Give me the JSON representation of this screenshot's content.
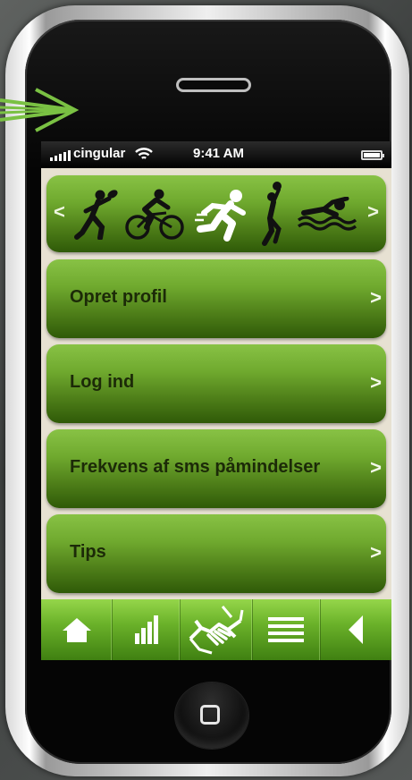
{
  "status_bar": {
    "carrier": "cingular",
    "time": "9:41 AM",
    "signal_icon": "signal-bars-icon",
    "wifi_icon": "wifi-icon",
    "battery_icon": "battery-icon"
  },
  "sports_row": {
    "prev_label": "<",
    "next_label": ">",
    "icons": [
      "rugby-player-icon",
      "cyclist-icon",
      "runner-icon",
      "basketball-player-icon",
      "swimmer-icon"
    ]
  },
  "menu": {
    "items": [
      {
        "label": "Opret profil",
        "chevron": ">"
      },
      {
        "label": "Log ind",
        "chevron": ">"
      },
      {
        "label": "Frekvens af sms påmindelser",
        "chevron": ">"
      },
      {
        "label": "Tips",
        "chevron": ">"
      }
    ]
  },
  "tab_bar": {
    "tabs": [
      "home-icon",
      "stats-bars-icon",
      "handshake-icon",
      "list-icon",
      "back-triangle-icon"
    ]
  },
  "colors": {
    "green_top": "#88c245",
    "green_bottom": "#2f5a08",
    "label_dark": "#1c2a08",
    "screen_bg": "#e7e1d2",
    "arrow_green": "#7ac143"
  }
}
